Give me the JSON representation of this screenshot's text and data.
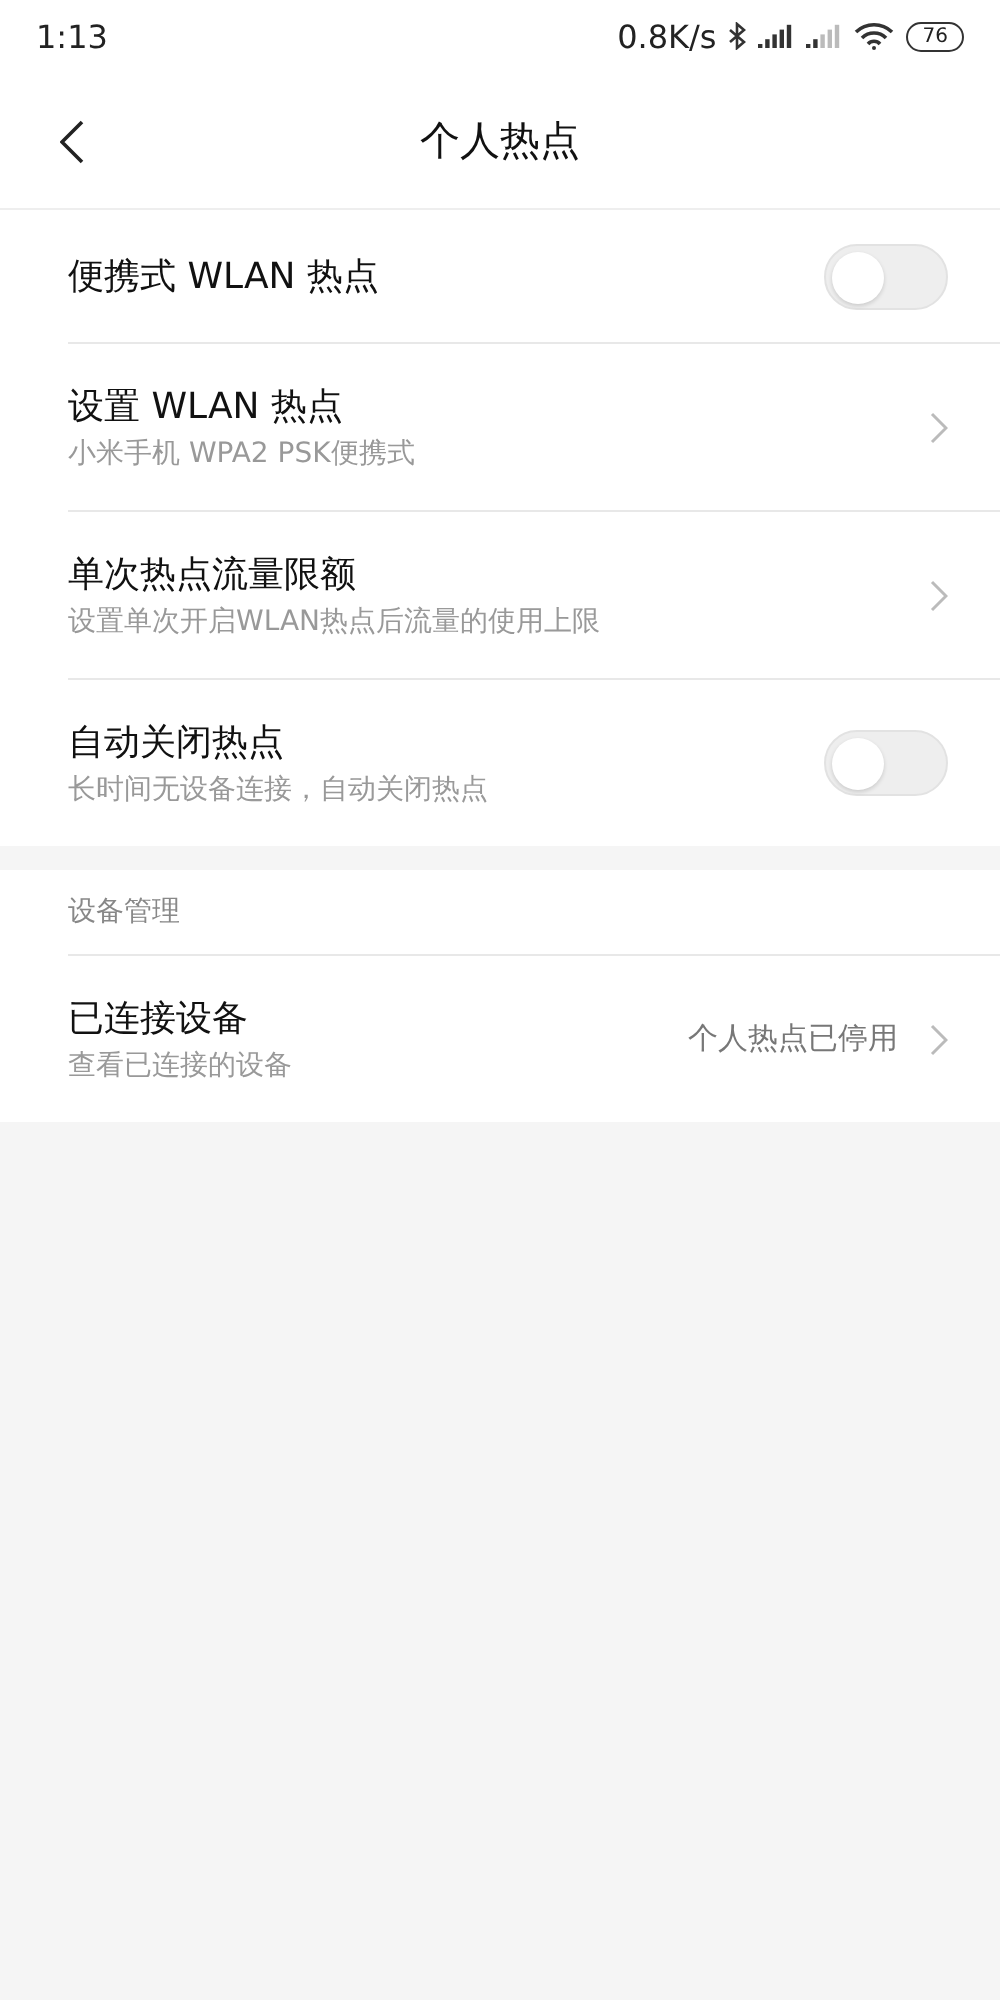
{
  "status_bar": {
    "time": "1:13",
    "speed": "0.8K/s",
    "battery": "76"
  },
  "header": {
    "title": "个人热点"
  },
  "sections": [
    {
      "rows": [
        {
          "kind": "toggle",
          "title": "便携式 WLAN 热点",
          "on": false
        },
        {
          "kind": "link",
          "title": "设置 WLAN 热点",
          "subtitle": "小米手机 WPA2 PSK便携式"
        },
        {
          "kind": "link",
          "title": "单次热点流量限额",
          "subtitle": "设置单次开启WLAN热点后流量的使用上限"
        },
        {
          "kind": "toggle",
          "title": "自动关闭热点",
          "subtitle": "长时间无设备连接，自动关闭热点",
          "on": false
        }
      ]
    },
    {
      "heading": "设备管理",
      "rows": [
        {
          "kind": "link",
          "title": "已连接设备",
          "subtitle": "查看已连接的设备",
          "value": "个人热点已停用"
        }
      ]
    }
  ]
}
